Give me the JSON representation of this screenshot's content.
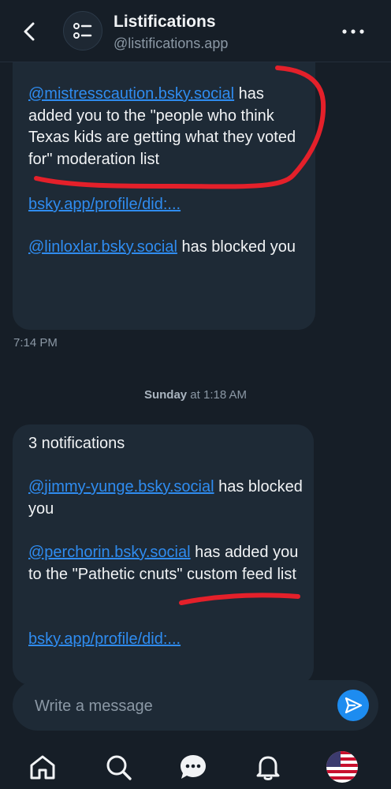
{
  "header": {
    "title": "Listifications",
    "handle": "@listifications.app"
  },
  "messages": {
    "first": {
      "p1_link": "@mistresscaution.bsky.social",
      "p1_text": " has added you to the \"people who think Texas kids are getting what they voted for\" moderation list",
      "p2_link": "bsky.app/profile/did:...",
      "p3_link": "@linloxlar.bsky.social",
      "p3_text": " has blocked you",
      "time": "7:14 PM"
    },
    "date_separator": {
      "day": "Sunday",
      "rest": " at 1:18 AM"
    },
    "second": {
      "count": "3 notifications",
      "p1_link": "@jimmy-yunge.bsky.social",
      "p1_text": " has blocked you",
      "p2_link": "@perchorin.bsky.social",
      "p2_text": " has added you to the \"Pathetic cnuts\" custom feed list",
      "p3_link": "bsky.app/profile/did:..."
    }
  },
  "composer": {
    "placeholder": "Write a message"
  },
  "colors": {
    "background": "#161e27",
    "bubble": "#1e2a36",
    "link": "#2f8cf0",
    "send": "#1d8cf0",
    "scribble": "#e4202a"
  },
  "icons": {
    "back": "chevron-left-icon",
    "avatar": "list-icon",
    "more": "ellipsis-icon",
    "send": "paper-plane-icon",
    "tabs": [
      "home-icon",
      "search-icon",
      "chat-icon",
      "bell-icon",
      "flag-avatar-icon"
    ]
  }
}
